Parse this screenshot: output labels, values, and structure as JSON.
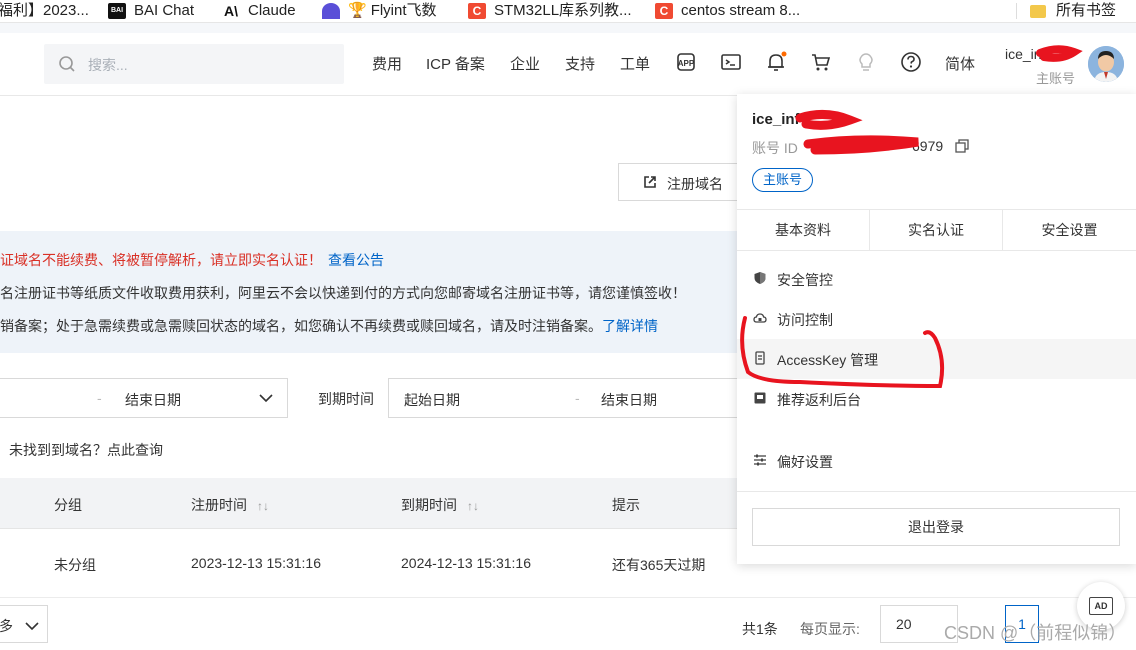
{
  "bookmarks": [
    {
      "label": "福利】2023...",
      "icon": "bookmark-icon"
    },
    {
      "label": "BAI Chat",
      "icon": "bai-logo-icon"
    },
    {
      "label": "Claude",
      "icon": "anthropic-logo-icon"
    },
    {
      "label": "Flyint飞数",
      "icon": "flyint-logo-icon"
    },
    {
      "label": "STM32LL库系列教...",
      "icon": "csdn-logo-icon"
    },
    {
      "label": "centos stream 8...",
      "icon": "csdn-logo-icon"
    }
  ],
  "all_bookmarks": "所有书签",
  "header": {
    "search_placeholder": "搜索...",
    "nav": [
      "费用",
      "ICP 备案",
      "企业",
      "支持",
      "工单",
      "简体"
    ],
    "user_name": "ice_inf",
    "user_role": "主账号"
  },
  "content": {
    "register_button": "注册域名",
    "notices": [
      {
        "text": "证域名不能续费、将被暂停解析，请立即实名认证！",
        "link": "查看公告"
      },
      {
        "text": "名注册证书等纸质文件收取费用获利，阿里云不会以快递到付的方式向您邮寄域名注册证书等，请您谨慎签收！",
        "link": ""
      },
      {
        "text": "销备案；处于急需续费或急需赎回状态的域名，如您确认不再续费或赎回域名，请及时注销备案。",
        "link": "了解详情"
      }
    ],
    "filter": {
      "end_date": "结束日期",
      "expire_label": "到期时间",
      "start_date": "起始日期",
      "end_date2": "结束日期",
      "not_found": "未找到到域名？点此查询"
    },
    "table": {
      "headers": [
        "分组",
        "注册时间",
        "到期时间",
        "提示"
      ],
      "rows": [
        {
          "group": "未分组",
          "reg_time": "2023-12-13 15:31:16",
          "expire_time": "2024-12-13 15:31:16",
          "hint": "还有365天过期"
        }
      ]
    },
    "footer": {
      "more": "多",
      "total": "共1条",
      "per_page_label": "每页显示:",
      "per_page": "20",
      "page": "1"
    }
  },
  "panel": {
    "user_name": "ice_inf",
    "account_id_label": "账号 ID",
    "account_id_value": "6979",
    "badge": "主账号",
    "tabs": [
      "基本资料",
      "实名认证",
      "安全设置"
    ],
    "menu": [
      {
        "label": "安全管控",
        "icon": "shield-icon"
      },
      {
        "label": "访问控制",
        "icon": "cloud-icon"
      },
      {
        "label": "AccessKey 管理",
        "icon": "key-icon"
      },
      {
        "label": "推荐返利后台",
        "icon": "gift-icon"
      },
      {
        "label": "偏好设置",
        "icon": "sliders-icon"
      }
    ],
    "logout": "退出登录"
  },
  "float_button": "AD",
  "watermark": "CSDN @（前程似锦）",
  "colors": {
    "accent": "#0064c8",
    "warning": "#d93026",
    "annotation": "#e8141f"
  }
}
